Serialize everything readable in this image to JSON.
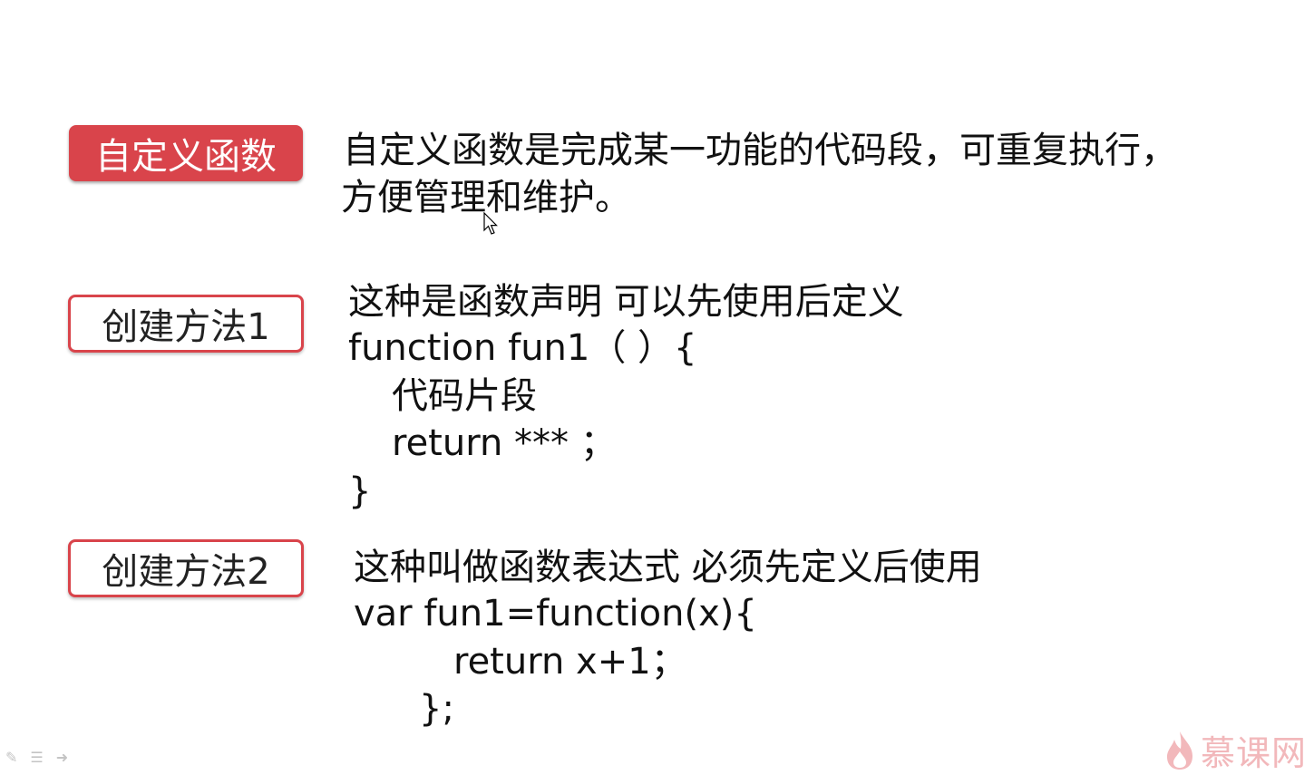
{
  "section1": {
    "tag": "自定义函数",
    "lines": [
      "自定义函数是完成某一功能的代码段，可重复执行，",
      "方便管理和维护。"
    ]
  },
  "section2": {
    "tag": "创建方法1",
    "lines": [
      "这种是函数声明 可以先使用后定义",
      "function fun1（ ）{",
      "代码片段",
      "return *** ；",
      "}"
    ]
  },
  "section3": {
    "tag": "创建方法2",
    "lines": [
      "这种叫做函数表达式 必须先定义后使用",
      "var fun1=function(x){",
      "return x+1；",
      "};"
    ]
  },
  "toolbar": {
    "icons": [
      "pen-icon",
      "menu-icon",
      "next-arrow-icon"
    ]
  },
  "logo": {
    "text": "慕课网"
  },
  "colors": {
    "accent": "#d9444b",
    "logo": "#f2b8bb"
  }
}
